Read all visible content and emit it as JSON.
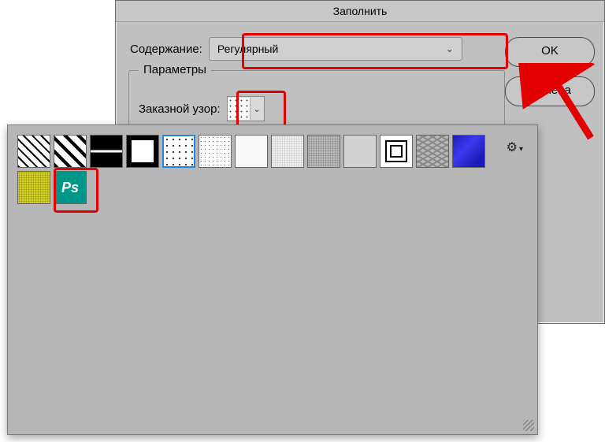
{
  "dialog": {
    "title": "Заполнить",
    "content_label": "Содержание:",
    "content_value": "Регулярный",
    "fieldset_legend": "Параметры",
    "pattern_label": "Заказной узор:",
    "ok": "OK",
    "cancel": "Отмена"
  },
  "panel": {
    "gear": "⚙",
    "gear_chev": "▾"
  },
  "swatches": [
    {
      "id": "diag-thin",
      "cls": "p-diag"
    },
    {
      "id": "diag-thick",
      "cls": "p-diag2"
    },
    {
      "id": "h-stripe",
      "cls": "p-hstripe"
    },
    {
      "id": "frame",
      "cls": "p-frame"
    },
    {
      "id": "dots",
      "cls": "p-dots",
      "selected": true
    },
    {
      "id": "small-dots",
      "cls": "p-smalldots"
    },
    {
      "id": "white",
      "cls": "p-white"
    },
    {
      "id": "light-noise",
      "cls": "p-lnoise"
    },
    {
      "id": "gray-noise",
      "cls": "p-gnoise"
    },
    {
      "id": "light-gray",
      "cls": "p-lgray"
    },
    {
      "id": "concentric",
      "cls": "p-sq"
    },
    {
      "id": "wavy",
      "cls": "p-wavy"
    },
    {
      "id": "blue",
      "cls": "p-blue"
    },
    {
      "id": "yellow",
      "cls": "p-yellow"
    },
    {
      "id": "ps-logo",
      "cls": "p-ps",
      "text": "Ps"
    }
  ]
}
